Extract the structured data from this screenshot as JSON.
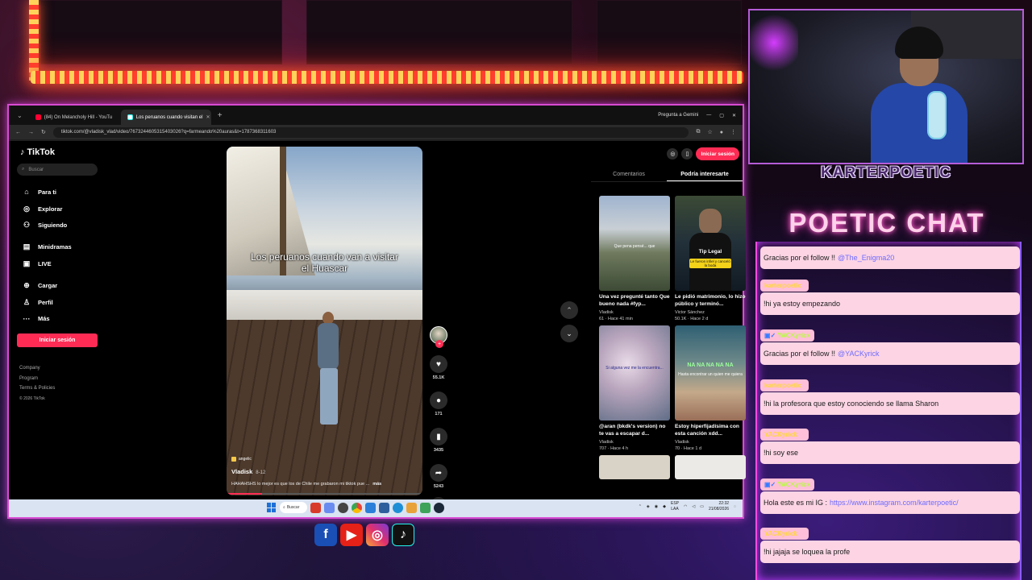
{
  "overlay": {
    "channel_name": "KARTERPOETIC",
    "chat_title": "POETIC CHAT",
    "social_icons": [
      "facebook-icon",
      "youtube-icon",
      "instagram-icon",
      "tiktok-icon"
    ]
  },
  "browser": {
    "tabs": [
      {
        "label": "(84) On Melancholy Hill - YouTu",
        "icon": "youtube-icon",
        "active": false
      },
      {
        "label": "Los peruanos cuando visitan el",
        "icon": "tiktok-icon",
        "active": true
      }
    ],
    "gemini_label": "Pregunta a Gemini",
    "url": "tiktok.com/@vladisk_vlad/video/7673244605315403026?q=farmeando%20auras&t=1787368311603"
  },
  "tiktok": {
    "logo": "TikTok",
    "search_placeholder": "Buscar",
    "nav": [
      "Para ti",
      "Explorar",
      "Siguiendo",
      "Minidramas",
      "LIVE",
      "Cargar",
      "Perfil",
      "Más"
    ],
    "login_button": "Iniciar sesión",
    "footer": [
      "Company",
      "Program",
      "Terms & Policies",
      "© 2026 TikTok"
    ]
  },
  "video": {
    "caption": "Los peruanos cuando van a visitar el Huascar",
    "sound": "angelic",
    "author": "Vladisk",
    "date": "8-12",
    "description": "HAHAHSHS lo mejor es que los de Chile me grabaron mi tiktok pue ...",
    "more": "más",
    "progress": 0.18,
    "counts": {
      "likes": "55.1K",
      "comments": "171",
      "saves": "3435",
      "shares": "5243"
    }
  },
  "right_panel": {
    "login_button": "Iniciar sesión",
    "tabs": [
      "Comentarios",
      "Podría interesarte"
    ],
    "active_tab": 1,
    "cards": [
      {
        "title": "Una vez pregunté tanto Que bueno nada #fyp...",
        "author": "Vladisk",
        "meta": "61 · Hace 41 min",
        "overlay": "Que pena pensé... que",
        "colors": [
          "#8fa7c6",
          "#7d8a6c"
        ]
      },
      {
        "title": "Le pidió matrimonio, lo hizo público y terminó...",
        "author": "Victor Sánchez",
        "meta": "50.1K · Hace 2 d",
        "overlay": "Tip Legal",
        "overlay2": "Le fueron infiel y canceló la boda",
        "colors": [
          "#2e3a2a",
          "#15202a"
        ]
      },
      {
        "title": "@aran (bkdk's version) no te vas a escapar d...",
        "author": "Vladisk",
        "meta": "707 · Hace 4 h",
        "overlay": "Si alguna vez me la encuentra...",
        "colors": [
          "#c2b6c9",
          "#5d6a80"
        ]
      },
      {
        "title": "Estoy hiperfijadísima con esta canción xdd...",
        "author": "Vladisk",
        "meta": "70 · Hace 1 d",
        "overlay": "NA NA NA NA NA",
        "overlay2": "Hasta encontrar un quien me quiera",
        "colors": [
          "#b5a67a",
          "#3a6a7a"
        ]
      }
    ]
  },
  "taskbar": {
    "search": "Buscar",
    "lang": "ESP",
    "lang2": "LAA",
    "time": "22:32",
    "date": "21/08/2026"
  },
  "chat": {
    "messages": [
      {
        "user": "",
        "text": "Gracias por el follow !!",
        "mention": "@The_Enigma20",
        "badge": false
      },
      {
        "user": "karterpoetic",
        "text": "!hi ya estoy empezando",
        "mention": "",
        "badge": false
      },
      {
        "user": "YACKyrick",
        "text": "Gracias por el follow !!",
        "mention": "@YACKyrick",
        "badge": true
      },
      {
        "user": "karterpoetic",
        "text": "!hi la profesora que estoy conociendo se llama Sharon",
        "mention": "",
        "badge": false
      },
      {
        "user": "YACKyrick",
        "text": "!hi soy ese",
        "mention": "",
        "badge": false
      },
      {
        "user": "YACKyrick",
        "text": "Hola este es mi IG :",
        "mention": "https://www.instagram.com/karterpoetic/",
        "badge": true
      },
      {
        "user": "YACKyrick",
        "text": "!hi jajaja se loquea la profe",
        "mention": "",
        "badge": false
      }
    ]
  },
  "colors": {
    "tiktok_red": "#fe2c55",
    "chat_bubble": "#fcd4e4",
    "neon_pink": "#ff4ce0",
    "mention_blue": "#6e6bff"
  }
}
